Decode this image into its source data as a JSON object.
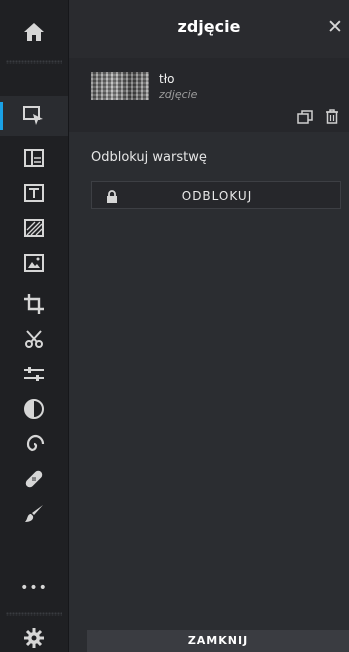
{
  "header": {
    "title": "zdjęcie",
    "close_glyph": "✕"
  },
  "layer": {
    "name": "tło",
    "type": "zdjęcie"
  },
  "unlock_section": {
    "title": "Odblokuj warstwę",
    "button_label": "ODBLOKUJ"
  },
  "footer": {
    "close_label": "ZAMKNIJ"
  },
  "sidebar": {
    "icons": [
      "home-icon",
      "select-icon",
      "layers-icon",
      "text-icon",
      "pattern-icon",
      "image-icon",
      "crop-icon",
      "cut-icon",
      "adjust-icon",
      "contrast-icon",
      "spiral-icon",
      "bandage-icon",
      "brush-icon",
      "more-icon",
      "settings-icon"
    ],
    "more_glyph": "•••"
  },
  "colors": {
    "accent": "#1aa1e6",
    "sidebar": "#1f2023",
    "panel": "#2b2d31"
  }
}
